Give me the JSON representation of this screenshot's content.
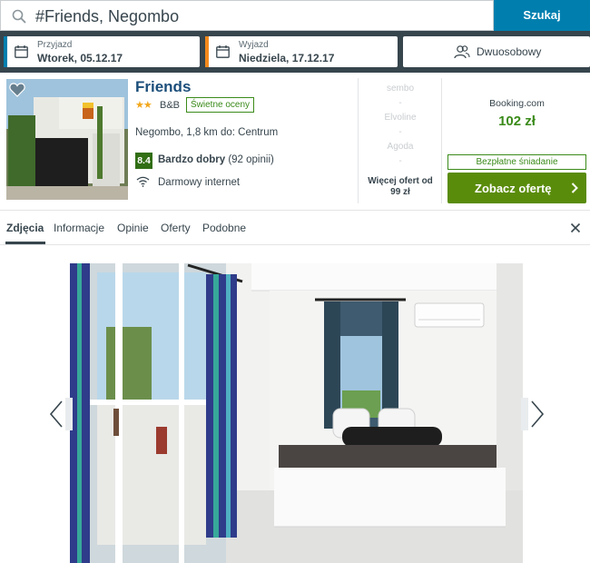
{
  "search": {
    "query": "#Friends, Negombo",
    "button_label": "Szukaj"
  },
  "dates": {
    "checkin_label": "Przyjazd",
    "checkin_value": "Wtorek, 05.12.17",
    "checkin_color": "#007faf",
    "checkout_label": "Wyjazd",
    "checkout_value": "Niedziela, 17.12.17",
    "checkout_color": "#f38a1c"
  },
  "room": {
    "value": "Dwuosobowy"
  },
  "hotel": {
    "name": "Friends",
    "stars": "★★",
    "type": "B&B",
    "badge": "Świetne oceny",
    "location": "Negombo, 1,8 km do: Centrum",
    "rating_score": "8.4",
    "rating_label": "Bardzo dobry",
    "rating_count": "(92 opinii)",
    "amenity": "Darmowy internet"
  },
  "other_deals": {
    "providers": [
      "sembo",
      "Elvoline",
      "Agoda"
    ],
    "dash": "-",
    "more_line1": "Więcej ofert od",
    "more_line2": "99 zł"
  },
  "main_deal": {
    "provider": "Booking.com",
    "price": "102 zł",
    "breakfast": "Bezpłatne śniadanie",
    "button_label": "Zobacz ofertę",
    "accent_color": "#5a8c0b"
  },
  "tabs": [
    {
      "label": "Zdjęcia",
      "active": true
    },
    {
      "label": "Informacje",
      "active": false
    },
    {
      "label": "Opinie",
      "active": false
    },
    {
      "label": "Oferty",
      "active": false
    },
    {
      "label": "Podobne",
      "active": false
    }
  ],
  "icons": {
    "search": "search-icon",
    "calendar": "calendar-icon",
    "people": "people-icon",
    "heart": "heart-icon",
    "wifi": "wifi-icon",
    "chevron_right": "chevron-right-icon",
    "close": "close-icon",
    "prev": "chevron-left-icon",
    "next": "chevron-right-icon"
  }
}
